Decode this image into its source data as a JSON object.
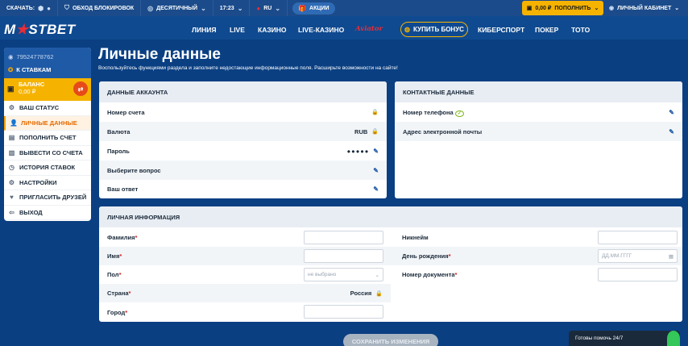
{
  "topbar": {
    "download_label": "СКАЧАТЬ:",
    "bypass_label": "ОБХОД БЛОКИРОВОК",
    "odds_format": "ДЕСЯТИЧНЫЙ",
    "time": "17:23",
    "lang": "RU",
    "promo_label": "АКЦИИ",
    "balance": "0,00 ₽",
    "deposit_label": "ПОПОЛНИТЬ",
    "cabinet_label": "ЛИЧНЫЙ КАБИНЕТ"
  },
  "brand": {
    "name_pre": "M",
    "name_post": "STBET",
    "star": "★",
    "accent": "#e62d38",
    "gold": "#f5b300"
  },
  "nav": {
    "line": "ЛИНИЯ",
    "live": "LIVE",
    "casino": "КАЗИНО",
    "live_casino": "LIVE-КАЗИНО",
    "aviator": "Aviator",
    "buy_bonus": "КУПИТЬ БОНУС",
    "esports": "КИБЕРСПОРТ",
    "poker": "ПОКЕР",
    "toto": "ТОТО"
  },
  "sidebar": {
    "phone": "79524778762",
    "to_bets": "К СТАВКАМ",
    "balance_label": "БАЛАНС",
    "balance_value": "0,00 ₽",
    "items": [
      {
        "label": "ВАШ СТАТУС",
        "icon": "status-icon",
        "glyph": "⚙"
      },
      {
        "label": "ЛИЧНЫЕ ДАННЫЕ",
        "icon": "person-icon",
        "glyph": "👤"
      },
      {
        "label": "ПОПОЛНИТЬ СЧЕТ",
        "icon": "deposit-icon",
        "glyph": "▤"
      },
      {
        "label": "ВЫВЕСТИ СО СЧЕТА",
        "icon": "withdraw-icon",
        "glyph": "▥"
      },
      {
        "label": "ИСТОРИЯ СТАВОК",
        "icon": "history-icon",
        "glyph": "◷"
      },
      {
        "label": "НАСТРОЙКИ",
        "icon": "settings-icon",
        "glyph": "⚙"
      },
      {
        "label": "ПРИГЛАСИТЬ ДРУЗЕЙ",
        "icon": "invite-icon",
        "glyph": "♥"
      },
      {
        "label": "ВЫХОД",
        "icon": "logout-icon",
        "glyph": "⇦"
      }
    ]
  },
  "page": {
    "title": "Личные данные",
    "subtitle": "Воспользуйтесь функциями раздела и заполните недостающие информационные поля. Расширьте возможности на сайте!"
  },
  "account": {
    "title": "ДАННЫЕ АККАУНТА",
    "account_number": "Номер счета",
    "currency": "Валюта",
    "currency_value": "RUB",
    "password": "Пароль",
    "password_mask": "●●●●●",
    "question": "Выберите вопрос",
    "answer": "Ваш ответ"
  },
  "contacts": {
    "title": "КОНТАКТНЫЕ ДАННЫЕ",
    "phone": "Номер телефона",
    "email": "Адрес электронной почты"
  },
  "personal": {
    "title": "ЛИЧНАЯ ИНФОРМАЦИЯ",
    "surname": "Фамилия",
    "name": "Имя",
    "gender": "Пол",
    "gender_placeholder": "не выбрано",
    "country": "Страна",
    "country_value": "Россия",
    "city": "Город",
    "nickname": "Никнейм",
    "birthday": "День рождения",
    "birthday_placeholder": "ДД.ММ.ГГГГ",
    "document": "Номер документа",
    "req": "*"
  },
  "actions": {
    "save": "СОХРАНИТЬ ИЗМЕНЕНИЯ"
  },
  "chat": {
    "label": "Готовы помочь 24/7"
  }
}
